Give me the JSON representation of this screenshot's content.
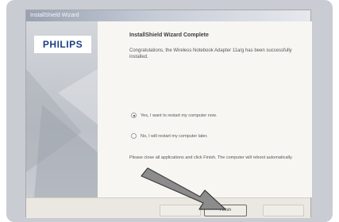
{
  "window": {
    "title": "InstallShield Wizard"
  },
  "sidebar": {
    "brand": "PHILIPS"
  },
  "main": {
    "heading": "InstallShield Wizard Complete",
    "message": "Congratulations, the Wireless Notebook Adapter 11a/g has been successfully installed.",
    "restart_options": [
      {
        "label": "Yes, I want to restart my computer now.",
        "selected": true
      },
      {
        "label": "No, I will restart my computer later.",
        "selected": false
      }
    ],
    "closing_note": "Please close all applications and click Finish. The computer will reboot automatically."
  },
  "footer": {
    "back_label": "",
    "finish_label": "Finish",
    "cancel_label": ""
  },
  "colors": {
    "brand": "#1f3f86",
    "frame": "#c9ccd3",
    "arrow": "#8c8c8c"
  }
}
